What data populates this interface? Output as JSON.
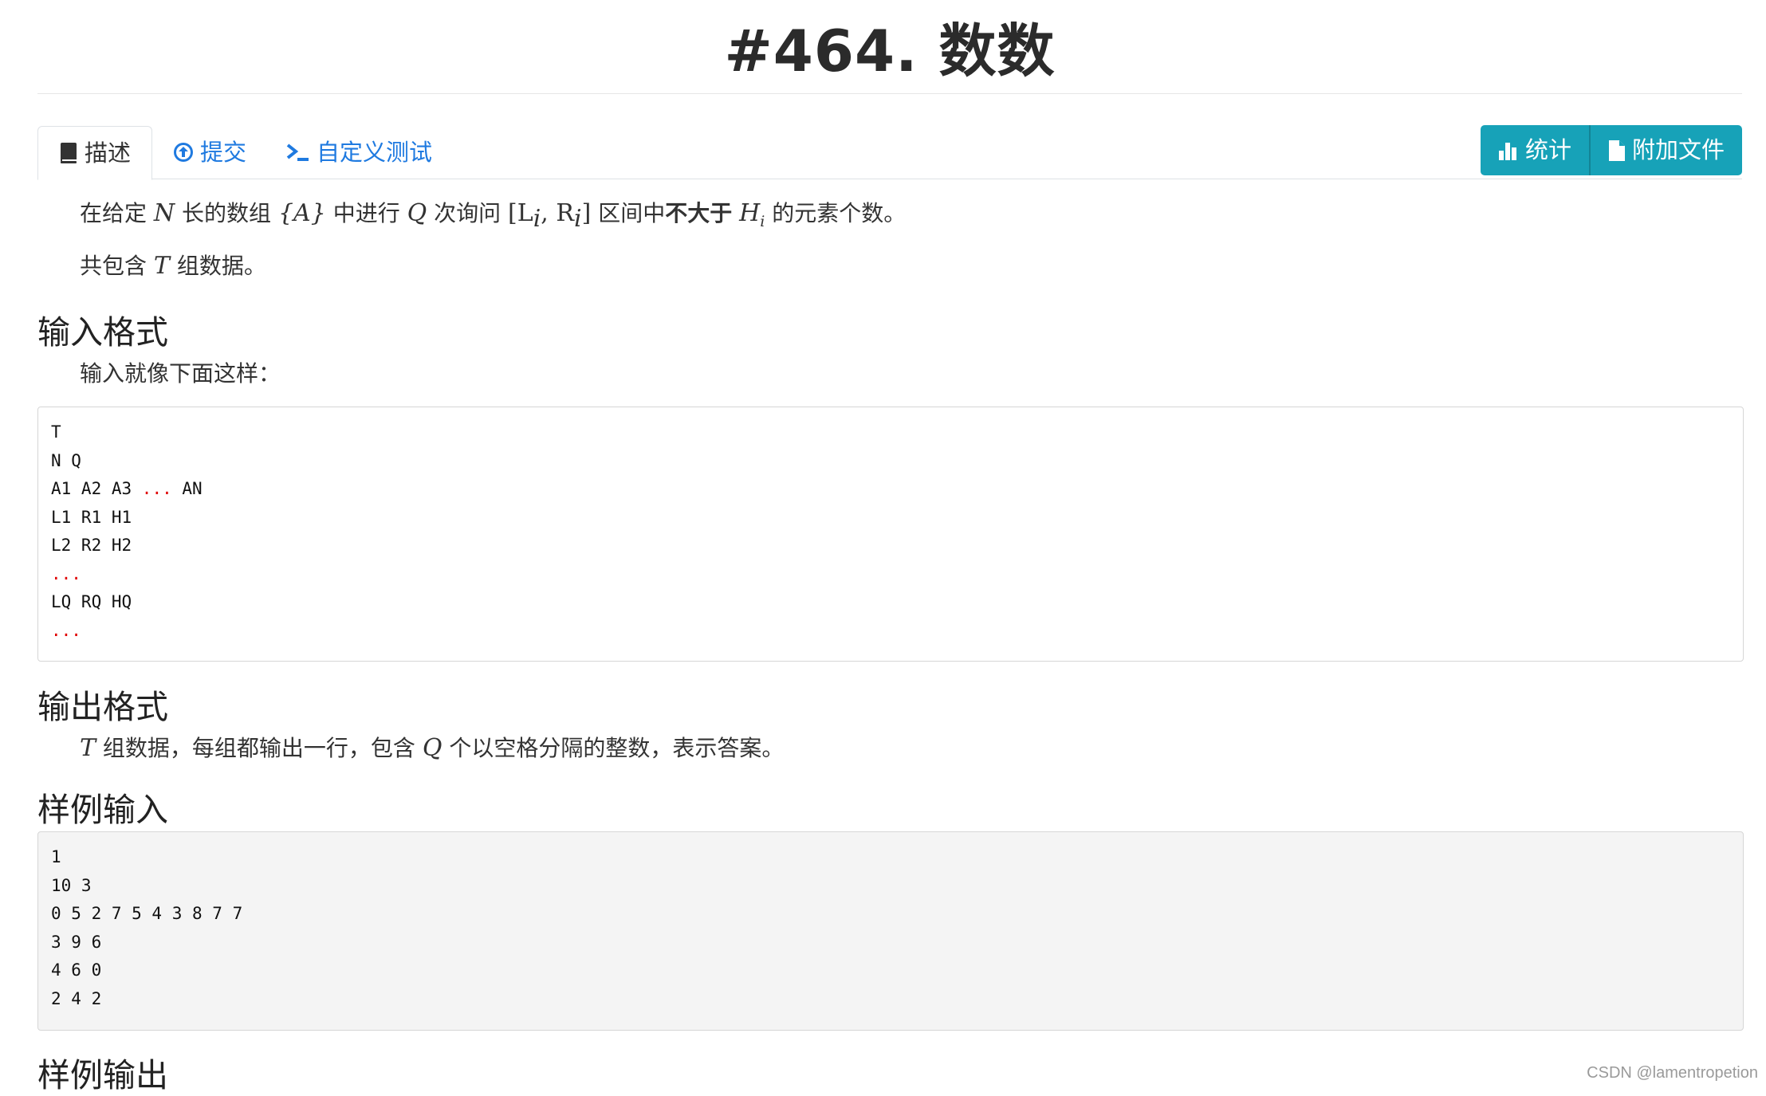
{
  "title": "#464. 数数",
  "tabs": [
    {
      "label": "描述",
      "icon": "book-icon",
      "active": true
    },
    {
      "label": "提交",
      "icon": "upload-circle-icon",
      "active": false
    },
    {
      "label": "自定义测试",
      "icon": "terminal-icon",
      "active": false
    }
  ],
  "actions": {
    "stats_label": "统计",
    "files_label": "附加文件"
  },
  "description": {
    "p1": {
      "t1": "在给定 ",
      "v1": "N",
      "t2": " 长的数组 ",
      "v2": "{A}",
      "t3": " 中进行 ",
      "v3": "Q",
      "t4": " 次询问 ",
      "v4a": "[L",
      "v4b": "i",
      "v4c": ", R",
      "v4d": "i",
      "v4e": "]",
      "t5": " 区间中",
      "bold": "不大于",
      "t6": " ",
      "v5a": "H",
      "v5b": "i",
      "t7": " 的元素个数。"
    },
    "p2": {
      "t1": "共包含 ",
      "v1": "T",
      "t2": " 组数据。"
    }
  },
  "input_format": {
    "heading": "输入格式",
    "intro": "输入就像下面这样：",
    "code": [
      {
        "text": "T",
        "red": ""
      },
      {
        "text": "N Q",
        "red": ""
      },
      {
        "text": "A1 A2 A3 ",
        "red": "...",
        "tail": " AN"
      },
      {
        "text": "L1 R1 H1",
        "red": ""
      },
      {
        "text": "L2 R2 H2",
        "red": ""
      },
      {
        "text": "",
        "red": "..."
      },
      {
        "text": "LQ RQ HQ",
        "red": ""
      },
      {
        "text": "",
        "red": "..."
      }
    ]
  },
  "output_format": {
    "heading": "输出格式",
    "v1": "T",
    "t1": " 组数据，每组都输出一行，包含 ",
    "v2": "Q",
    "t2": " 个以空格分隔的整数，表示答案。"
  },
  "sample_input": {
    "heading": "样例输入",
    "lines": [
      "1",
      "10 3",
      "0 5 2 7 5 4 3 8 7 7",
      "3 9 6",
      "4 6 0",
      "2 4 2"
    ]
  },
  "sample_output": {
    "heading": "样例输出"
  },
  "watermark": "CSDN @lamentropetion"
}
